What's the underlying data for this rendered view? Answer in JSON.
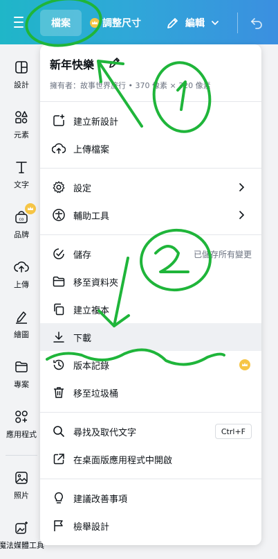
{
  "topbar": {
    "file_label": "檔案",
    "resize_label": "調整尺寸",
    "edit_label": "編輯"
  },
  "rail": {
    "items": [
      {
        "label": "設計",
        "icon": "layout-icon"
      },
      {
        "label": "元素",
        "icon": "shapes-icon"
      },
      {
        "label": "文字",
        "icon": "text-icon"
      },
      {
        "label": "品牌",
        "icon": "brand-icon"
      },
      {
        "label": "上傳",
        "icon": "upload-icon"
      },
      {
        "label": "繪圖",
        "icon": "draw-icon"
      },
      {
        "label": "專案",
        "icon": "folder-icon"
      },
      {
        "label": "應用程式",
        "icon": "apps-icon"
      },
      {
        "label": "照片",
        "icon": "photo-icon"
      },
      {
        "label": "魔法媒體工具",
        "icon": "magic-media-icon"
      }
    ]
  },
  "menu": {
    "design_title": "新年快樂",
    "owner_line": "擁有者：故事世界旅行 • 370 像素 × 320 像素",
    "items": [
      {
        "label": "建立新設計",
        "icon": "add-design-icon"
      },
      {
        "label": "上傳檔案",
        "icon": "upload-cloud-icon"
      },
      {
        "label": "設定",
        "icon": "gear-icon"
      },
      {
        "label": "輔助工具",
        "icon": "accessibility-icon"
      },
      {
        "label": "儲存",
        "icon": "saved-icon",
        "hint": "已儲存所有變更"
      },
      {
        "label": "移至資料夾",
        "icon": "folder-icon"
      },
      {
        "label": "建立複本",
        "icon": "copy-icon"
      },
      {
        "label": "下載",
        "icon": "download-icon"
      },
      {
        "label": "版本記錄",
        "icon": "history-icon"
      },
      {
        "label": "移至垃圾桶",
        "icon": "trash-icon"
      },
      {
        "label": "尋找及取代文字",
        "icon": "search-icon",
        "shortcut": "Ctrl+F"
      },
      {
        "label": "在桌面版應用程式中開啟",
        "icon": "external-open-icon"
      },
      {
        "label": "建議改善事項",
        "icon": "lightbulb-icon"
      },
      {
        "label": "檢舉設計",
        "icon": "flag-icon"
      }
    ]
  },
  "colors": {
    "topbar_start": "#1fb6c8",
    "topbar_end": "#3b8fe0",
    "annotation": "#1fb53a",
    "crown": "#f6c546"
  }
}
